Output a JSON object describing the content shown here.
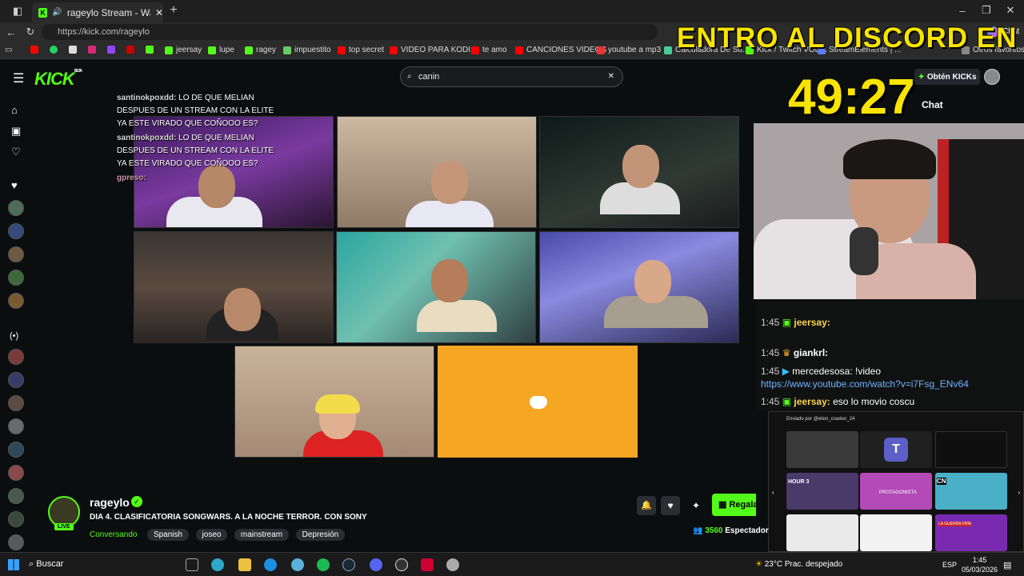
{
  "browser": {
    "tab_title": "rageylo Stream - Watch Live o",
    "url": "https://kick.com/rageylo"
  },
  "bookmarks": [
    "jeersay",
    "lupe",
    "ragey",
    "impuestito",
    "top secret",
    "VIDEO PARA KODI...",
    "te amo",
    "CANCIONES VIDEOS",
    "youtube a mp3",
    "Calculadora De Su...",
    "Kick / Twitch VOD...",
    "StreamElements | ...",
    "Otros favoritos"
  ],
  "overlay": {
    "title": "ENTRO AL DISCORD EN",
    "timer": "49:27"
  },
  "header": {
    "logo": "KICK",
    "beta": "BETA",
    "search_value": "canin",
    "get_kicks": "Obtén KICKs",
    "chat_label": "Chat",
    "browser_chat": "Chat"
  },
  "chat_overlay": [
    {
      "user": "santinokpoxdd:",
      "text": "LO DE QUE MELIAN DESPUES DE UN STREAM CON LA ELITE YA ESTE VIRADO QUE COÑOOO ES?"
    },
    {
      "user": "santinokpoxdd:",
      "text": "LO DE QUE MELIAN DESPUES DE UN STREAM CON LA ELITE YA ESTE VIRADO QUE COÑOOO ES?"
    },
    {
      "user": "gpreso:",
      "text": ""
    }
  ],
  "chat": [
    {
      "time": "1:45",
      "user": "jeersay:",
      "text": ""
    },
    {
      "time": "1:45",
      "user": "giankrl:",
      "text": ""
    },
    {
      "time": "1:45",
      "user": "mercedesosa:",
      "text": "!video"
    },
    {
      "time": "",
      "user": "",
      "text": "https://www.youtube.com/watch?v=i7Fsg_ENv64"
    },
    {
      "time": "1:45",
      "user": "jeersay:",
      "text": "eso lo movio coscu"
    }
  ],
  "media_panel": {
    "sender": "Enviado por @elion_craxker_24",
    "hour_label": "HOUR 3",
    "tile_label": "PROTAGONISTA",
    "cn": "CN",
    "war": "LA GUERRA FRÍA"
  },
  "stream": {
    "name": "rageylo",
    "live": "LIVE",
    "title": "DIA 4. CLASIFICATORIA SONGWARS. A LA NOCHE TERROR. CON SONY",
    "category": "Conversando",
    "tags": [
      "Spanish",
      "joseo",
      "mainstream",
      "Depresión"
    ],
    "viewers": "3560",
    "viewers_label": "Espectador",
    "gift_label": "Regala Su"
  },
  "taskbar": {
    "search": "Buscar",
    "weather": "23°C  Prac. despejado",
    "lang": "ESP",
    "time": "1:45",
    "date": "05/03/2026"
  },
  "colors": {
    "kick_green": "#53fc18",
    "overlay_yellow": "#f9e400",
    "discord_orange": "#f5a623"
  }
}
